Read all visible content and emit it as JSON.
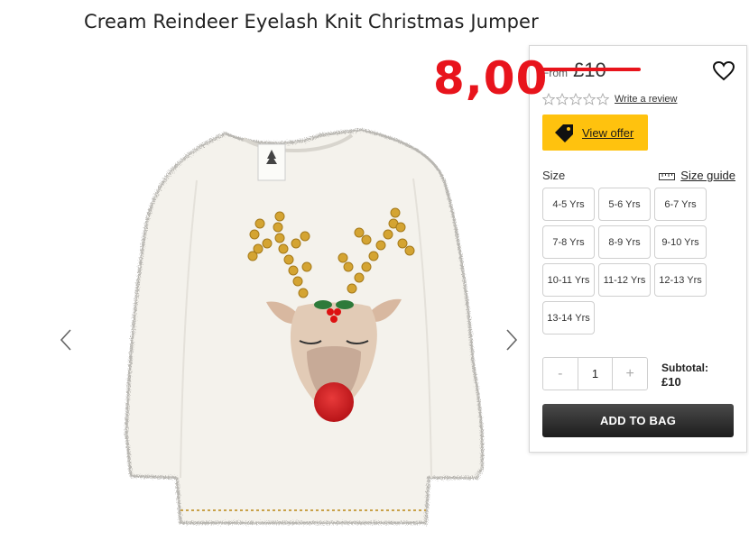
{
  "product": {
    "title": "Cream Reindeer Eyelash Knit Christmas Jumper",
    "image_alt": "Cream reindeer eyelash knit jumper"
  },
  "overlay": {
    "sale_price": "8,00",
    "sale_color": "#e8141c"
  },
  "price": {
    "from_label": "From",
    "original": "£10"
  },
  "rating": {
    "stars_filled": 0,
    "stars_total": 5,
    "review_link": "Write a review"
  },
  "offer": {
    "label": "View offer",
    "color": "#ffc20e"
  },
  "size": {
    "label": "Size",
    "guide_label": "Size guide",
    "options": [
      "4-5 Yrs",
      "5-6 Yrs",
      "6-7 Yrs",
      "7-8 Yrs",
      "8-9 Yrs",
      "9-10 Yrs",
      "10-11 Yrs",
      "11-12 Yrs",
      "12-13 Yrs",
      "13-14 Yrs"
    ]
  },
  "quantity": {
    "minus": "-",
    "value": "1",
    "plus": "+"
  },
  "subtotal": {
    "label": "Subtotal:",
    "value": "£10"
  },
  "add_to_bag": {
    "label": "ADD TO BAG"
  },
  "gallery": {
    "prev_icon": "chevron-left-icon",
    "next_icon": "chevron-right-icon"
  }
}
